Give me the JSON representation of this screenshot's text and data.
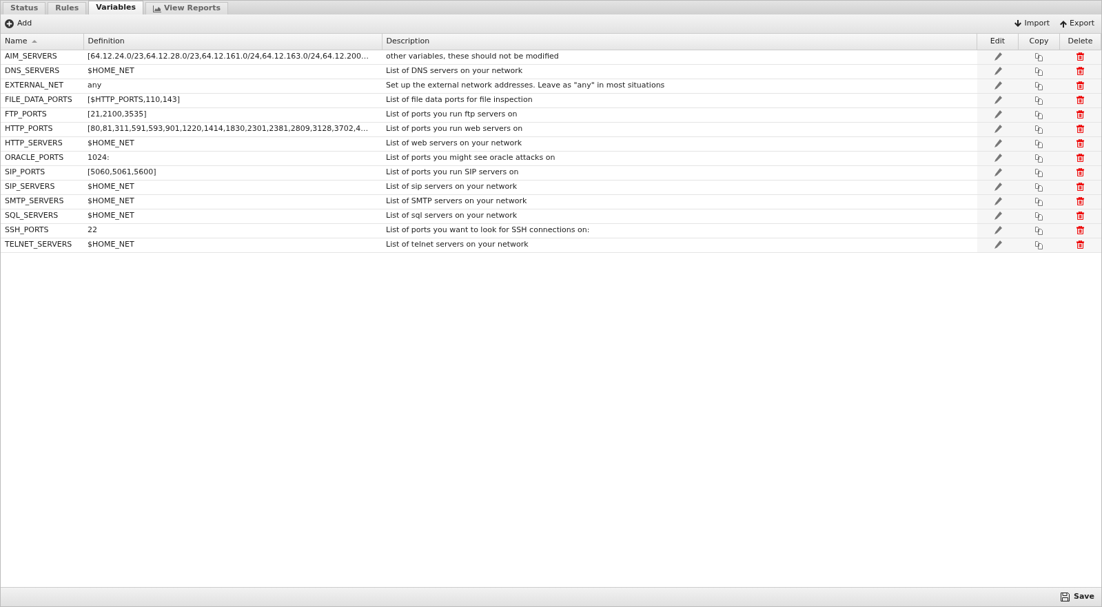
{
  "tabs": [
    {
      "label": "Status",
      "selected": false,
      "kind": "text"
    },
    {
      "label": "Rules",
      "selected": false,
      "kind": "text"
    },
    {
      "label": "Variables",
      "selected": true,
      "kind": "text"
    },
    {
      "label": "View Reports",
      "selected": false,
      "kind": "chart"
    }
  ],
  "toolbar": {
    "add": "Add",
    "import": "Import",
    "export": "Export"
  },
  "table": {
    "columns": [
      {
        "label": "Name",
        "sorted": true
      },
      {
        "label": "Definition"
      },
      {
        "label": "Description"
      },
      {
        "label": "Edit"
      },
      {
        "label": "Copy"
      },
      {
        "label": "Delete"
      }
    ],
    "rows": [
      {
        "name": "AIM_SERVERS",
        "definition": "[64.12.24.0/23,64.12.28.0/23,64.12.161.0/24,64.12.163.0/24,64.12.200…",
        "description": "other variables, these should not be modified"
      },
      {
        "name": "DNS_SERVERS",
        "definition": "$HOME_NET",
        "description": "List of DNS servers on your network"
      },
      {
        "name": "EXTERNAL_NET",
        "definition": "any",
        "description": "Set up the external network addresses. Leave as \"any\" in most situations"
      },
      {
        "name": "FILE_DATA_PORTS",
        "definition": "[$HTTP_PORTS,110,143]",
        "description": "List of file data ports for file inspection"
      },
      {
        "name": "FTP_PORTS",
        "definition": "[21,2100,3535]",
        "description": "List of ports you run ftp servers on"
      },
      {
        "name": "HTTP_PORTS",
        "definition": "[80,81,311,591,593,901,1220,1414,1830,2301,2381,2809,3128,3702,4…",
        "description": "List of ports you run web servers on"
      },
      {
        "name": "HTTP_SERVERS",
        "definition": "$HOME_NET",
        "description": "List of web servers on your network"
      },
      {
        "name": "ORACLE_PORTS",
        "definition": "1024:",
        "description": "List of ports you might see oracle attacks on"
      },
      {
        "name": "SIP_PORTS",
        "definition": "[5060,5061,5600]",
        "description": "List of ports you run SIP servers on"
      },
      {
        "name": "SIP_SERVERS",
        "definition": "$HOME_NET",
        "description": "List of sip servers on your network"
      },
      {
        "name": "SMTP_SERVERS",
        "definition": "$HOME_NET",
        "description": "List of SMTP servers on your network"
      },
      {
        "name": "SQL_SERVERS",
        "definition": "$HOME_NET",
        "description": "List of sql servers on your network"
      },
      {
        "name": "SSH_PORTS",
        "definition": "22",
        "description": "List of ports you want to look for SSH connections on:"
      },
      {
        "name": "TELNET_SERVERS",
        "definition": "$HOME_NET",
        "description": "List of telnet servers on your network"
      }
    ]
  },
  "footer": {
    "save": "Save"
  }
}
